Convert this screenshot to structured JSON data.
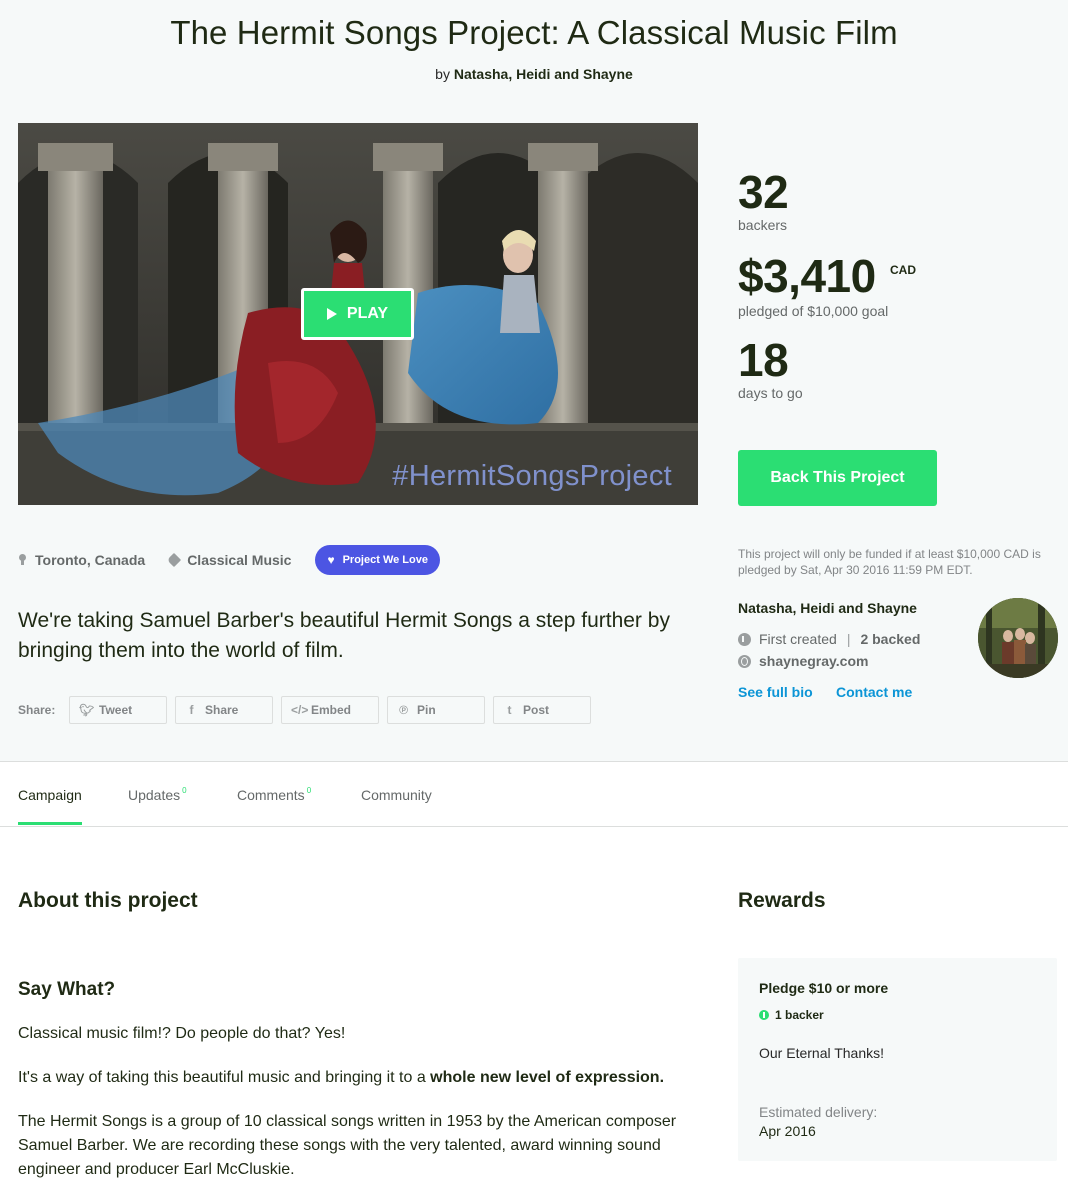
{
  "project": {
    "title": "The Hermit Songs Project: A Classical Music Film",
    "by_prefix": "by",
    "creator": "Natasha, Heidi and Shayne"
  },
  "video": {
    "play_label": "PLAY",
    "watermark": "#HermitSongsProject"
  },
  "stats": {
    "backers": "32",
    "backers_label": "backers",
    "pledged": "$3,410",
    "currency": "CAD",
    "pledged_label": "pledged of $10,000 goal",
    "days": "18",
    "days_label": "days to go"
  },
  "cta": {
    "back_label": "Back This Project",
    "funding_note": "This project will only be funded if at least $10,000 CAD is pledged by Sat, Apr 30 2016 11:59 PM EDT."
  },
  "creator_box": {
    "name": "Natasha, Heidi and Shayne",
    "first_created": "First created",
    "backed": "2 backed",
    "website": "shaynegray.com",
    "bio_link": "See full bio",
    "contact_link": "Contact me"
  },
  "meta": {
    "location": "Toronto, Canada",
    "category": "Classical Music",
    "badge": "Project We Love"
  },
  "blurb": "We're taking Samuel Barber's beautiful Hermit Songs a step further by bringing them into the world of film.",
  "share": {
    "label": "Share:",
    "buttons": [
      {
        "label": "Tweet",
        "icon": "twitter-icon"
      },
      {
        "label": "Share",
        "icon": "facebook-icon"
      },
      {
        "label": "Embed",
        "icon": "embed-icon"
      },
      {
        "label": "Pin",
        "icon": "pinterest-icon"
      },
      {
        "label": "Post",
        "icon": "tumblr-icon"
      }
    ]
  },
  "tabs": [
    {
      "label": "Campaign",
      "count": ""
    },
    {
      "label": "Updates",
      "count": "0"
    },
    {
      "label": "Comments",
      "count": "0"
    },
    {
      "label": "Community",
      "count": ""
    }
  ],
  "about": {
    "heading": "About this project",
    "subheading": "Say What?",
    "p1": "Classical music film!? Do people do that? Yes!",
    "p2_start": "It's a way of taking this beautiful music and bringing it to a ",
    "p2_bold": "whole new level of expression.",
    "p3": "The Hermit Songs is a group of 10 classical songs written in 1953 by the American composer Samuel Barber. We are recording these songs with the very talented, award winning sound engineer and producer Earl McCluskie."
  },
  "rewards": {
    "heading": "Rewards",
    "items": [
      {
        "title": "Pledge $10 or more",
        "backers": "1 backer",
        "description": "Our Eternal Thanks!",
        "delivery_label": "Estimated delivery:",
        "delivery": "Apr 2016"
      }
    ]
  },
  "colors": {
    "accent": "#2bde73",
    "badge": "#4c55e3",
    "link": "#0c95d6",
    "hero_bg": "#f6f9f9"
  }
}
